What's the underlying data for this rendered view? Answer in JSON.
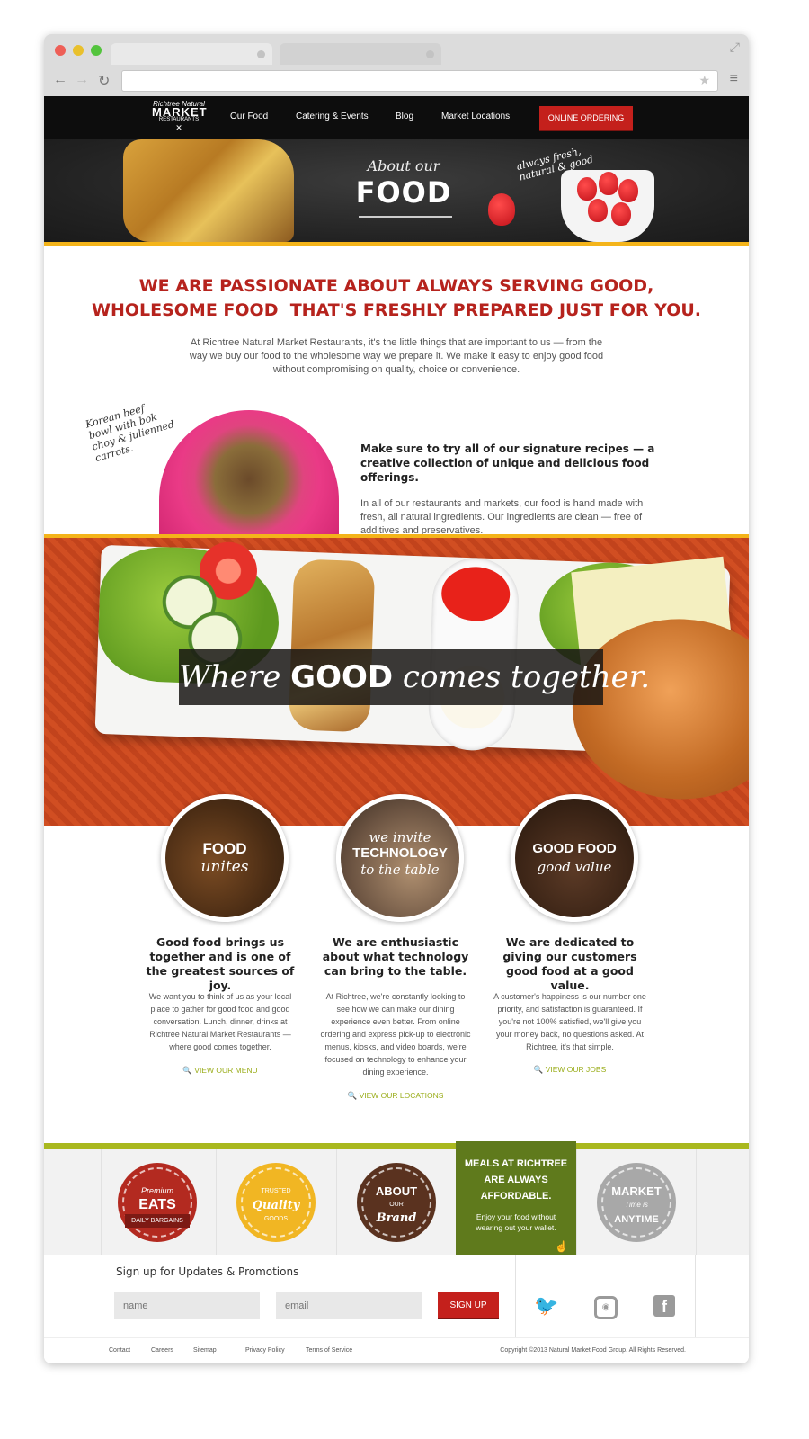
{
  "nav": {
    "logo_top": "Richtree Natural",
    "logo_main": "MARKET",
    "logo_bottom": "RESTAURANTS",
    "links": [
      "Our Food",
      "Catering & Events",
      "Blog",
      "Market Locations"
    ],
    "order_button": "ONLINE ORDERING"
  },
  "hero": {
    "title_small": "About our",
    "title_big": "FOOD",
    "fresh_note": "always fresh, natural & good"
  },
  "intro": {
    "title_line1": "WE ARE PASSIONATE ABOUT ALWAYS SERVING GOOD,",
    "title_line2": "WHOLESOME FOOD  THAT'S FRESHLY PREPARED JUST FOR YOU.",
    "text": "At Richtree Natural Market Restaurants, it's the little things that are important to us — from the way we buy our food to the wholesome way we prepare it. We make it easy to enjoy good food without compromising on quality, choice or convenience."
  },
  "signature": {
    "bowl_note": "Korean beef bowl with bok choy & julienned carrots.",
    "title": "Make sure to try all of our signature recipes — a creative collection of unique and delicious food offerings.",
    "text": "In all of our restaurants and markets, our food is hand made with fresh, all natural ingredients. Our ingredients are clean — free of additives and preservatives."
  },
  "banner": {
    "tag_pre": "Where ",
    "tag_bold": "GOOD",
    "tag_post": " comes together."
  },
  "columns": [
    {
      "circle_bold": "FOOD",
      "circle_italic": "unites",
      "title": "Good food brings us together and is one of the greatest sources of joy.",
      "text": "We want you to think of us as your  local place to gather for good food and good conversation. Lunch, dinner, drinks at Richtree Natural Market Restaurants — where good comes together.",
      "link": "VIEW OUR MENU"
    },
    {
      "circle_italic_top": "we invite",
      "circle_bold": "TECHNOLOGY",
      "circle_italic": "to the table",
      "title": "We are enthusiastic about what technology can bring to the table.",
      "text": "At Richtree, we're constantly looking to see how we can make our dining experience even better. From online ordering and express pick-up to electronic menus, kiosks, and video boards, we're focused on technology to enhance your dining experience.",
      "link": "VIEW OUR LOCATIONS"
    },
    {
      "circle_bold": "GOOD FOOD",
      "circle_italic": "good value",
      "title": "We are dedicated to giving our customers good food at a good value.",
      "text": "A customer's happiness is our number one priority, and satisfaction is guaranteed. If you're not 100% satisfied, we'll give you your money back, no questions asked. At Richtree, it's that simple.",
      "link": "VIEW OUR JOBS"
    }
  ],
  "badges": {
    "b1_small": "Premium",
    "b1_main": "EATS",
    "b1_ribbon": "DAILY BARGAINS",
    "b2_small": "TRUSTED",
    "b2_main": "Quality",
    "b2_sub": "GOODS",
    "b3_main": "ABOUT",
    "b3_small": "OUR",
    "b3_sub": "Brand",
    "affordable_title": "MEALS AT RICHTREE ARE ALWAYS AFFORDABLE.",
    "affordable_text": "Enjoy your food without wearing out your wallet.",
    "b5_main": "MARKET",
    "b5_small": "Time is",
    "b5_sub": "ANYTIME"
  },
  "signup": {
    "title": "Sign up for Updates & Promotions",
    "name_placeholder": "name",
    "email_placeholder": "email",
    "button": "SIGN UP"
  },
  "footer": {
    "links": [
      "Contact",
      "Careers",
      "Sitemap",
      "Privacy Policy",
      "Terms of Service"
    ],
    "copyright": "Copyright ©2013 Natural Market Food Group. All Rights Reserved."
  },
  "colors": {
    "brand_red": "#b6231d",
    "accent_yellow": "#f4b41a",
    "accent_green": "#a9b81e"
  }
}
